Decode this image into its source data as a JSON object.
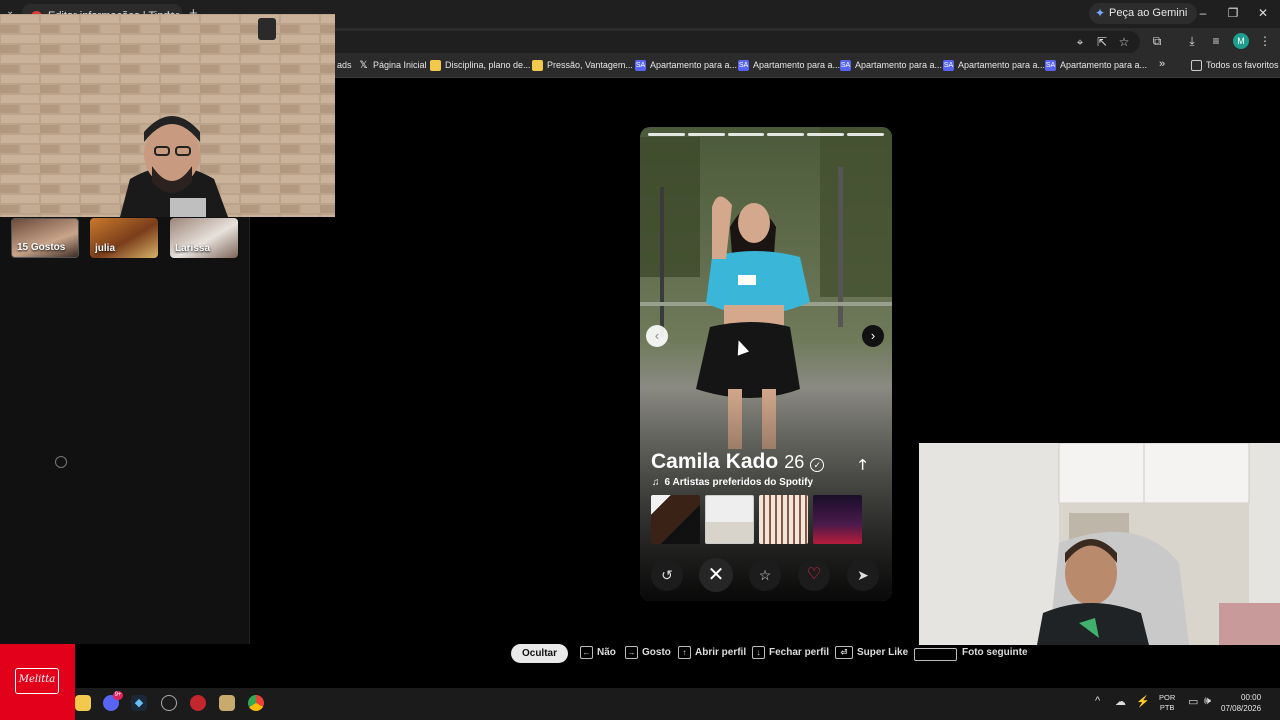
{
  "browser": {
    "tab_title": "Editar informações | Tinder",
    "new_tab": "+",
    "gemini_button": "Peça ao Gemini",
    "minimize": "–",
    "restore": "❐",
    "close": "✕",
    "bookmarks": [
      {
        "label": "ads",
        "icon": "none"
      },
      {
        "label": "Página Inicial",
        "icon": "x-icon"
      },
      {
        "label": "Disciplina, plano de...",
        "icon": "folder-icon"
      },
      {
        "label": "Pressão, Vantagem...",
        "icon": "folder-icon"
      },
      {
        "label": "Apartamento para a...",
        "icon": "sa-icon"
      },
      {
        "label": "Apartamento para a...",
        "icon": "sa-icon"
      },
      {
        "label": "Apartamento para a...",
        "icon": "sa-icon"
      },
      {
        "label": "Apartamento para a...",
        "icon": "sa-icon"
      },
      {
        "label": "Apartamento para a...",
        "icon": "sa-icon"
      }
    ],
    "bookmarks_overflow": "»",
    "all_bookmarks": "Todos os favoritos",
    "profile_initial": "M"
  },
  "sidebar": {
    "matches": [
      {
        "label": "15 Gostos"
      },
      {
        "label": "julia"
      },
      {
        "label": "Larissa"
      }
    ]
  },
  "profile": {
    "name": "Camila Kado",
    "age": "26",
    "photo_count": 6,
    "current_photo": 1,
    "spotify_label": "6 Artistas preferidos do Spotify",
    "album_count": 4
  },
  "hints": {
    "hide": "Ocultar",
    "nope": "Não",
    "like": "Gosto",
    "open_profile": "Abrir perfil",
    "close_profile": "Fechar perfil",
    "super_like": "Super Like",
    "next_photo": "Foto seguinte"
  },
  "taskbar": {
    "discord_badge": "9+",
    "lang_1": "POR",
    "lang_2": "PTB",
    "time": "00:00",
    "date": "07/08/2026"
  },
  "brand": {
    "accent_like": "#ff2d55",
    "melitta_red": "#e3001b"
  }
}
